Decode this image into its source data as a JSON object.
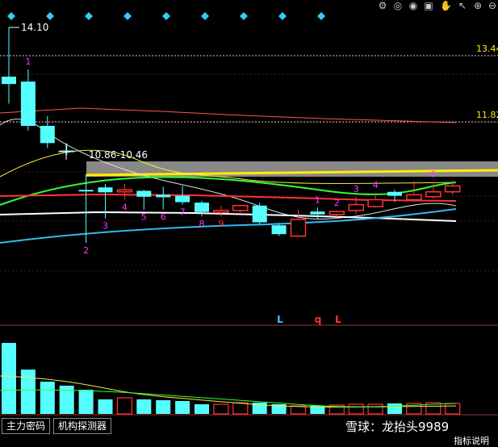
{
  "chart_data": {
    "type": "candlestick",
    "price_labels": {
      "high": "14.10",
      "range": "10.86-10.46",
      "right_top": "13.44",
      "right_mid": "11.82"
    },
    "candles": [
      {
        "o": 13.1,
        "c": 12.95,
        "h": 14.1,
        "l": 12.55,
        "up": false
      },
      {
        "o": 13.0,
        "c": 12.1,
        "h": 13.25,
        "l": 12.0,
        "up": false
      },
      {
        "o": 12.1,
        "c": 11.75,
        "h": 12.3,
        "l": 11.65,
        "up": false
      },
      {
        "o": 11.6,
        "c": 11.6,
        "h": 11.75,
        "l": 11.5,
        "up": false
      },
      {
        "o": 10.8,
        "c": 10.78,
        "h": 11.12,
        "l": 9.72,
        "up": false
      },
      {
        "o": 10.85,
        "c": 10.75,
        "h": 10.92,
        "l": 10.22,
        "up": false
      },
      {
        "o": 10.8,
        "c": 10.76,
        "h": 10.92,
        "l": 10.6,
        "up": true
      },
      {
        "o": 10.78,
        "c": 10.66,
        "h": 10.8,
        "l": 10.4,
        "up": false
      },
      {
        "o": 10.7,
        "c": 10.65,
        "h": 10.86,
        "l": 10.4,
        "up": false
      },
      {
        "o": 10.68,
        "c": 10.55,
        "h": 10.88,
        "l": 10.5,
        "up": false
      },
      {
        "o": 10.54,
        "c": 10.35,
        "h": 10.58,
        "l": 10.26,
        "up": false
      },
      {
        "o": 10.34,
        "c": 10.38,
        "h": 10.48,
        "l": 10.26,
        "up": true
      },
      {
        "o": 10.38,
        "c": 10.48,
        "h": 10.5,
        "l": 10.34,
        "up": true
      },
      {
        "o": 10.48,
        "c": 10.14,
        "h": 10.54,
        "l": 10.1,
        "up": false
      },
      {
        "o": 10.08,
        "c": 9.9,
        "h": 10.12,
        "l": 9.86,
        "up": false
      },
      {
        "o": 9.86,
        "c": 10.2,
        "h": 10.4,
        "l": 9.84,
        "up": true
      },
      {
        "o": 10.36,
        "c": 10.3,
        "h": 10.44,
        "l": 10.2,
        "up": false
      },
      {
        "o": 10.3,
        "c": 10.36,
        "h": 10.38,
        "l": 10.25,
        "up": true
      },
      {
        "o": 10.38,
        "c": 10.5,
        "h": 10.66,
        "l": 10.3,
        "up": true
      },
      {
        "o": 10.46,
        "c": 10.6,
        "h": 10.74,
        "l": 10.44,
        "up": true
      },
      {
        "o": 10.68,
        "c": 10.76,
        "h": 10.8,
        "l": 10.56,
        "up": false
      },
      {
        "o": 10.6,
        "c": 10.7,
        "h": 10.98,
        "l": 10.58,
        "up": true
      },
      {
        "o": 10.66,
        "c": 10.76,
        "h": 10.96,
        "l": 10.62,
        "up": true
      },
      {
        "o": 10.76,
        "c": 10.88,
        "h": 11.0,
        "l": 10.7,
        "up": true
      }
    ],
    "candle_labels": [
      {
        "i": 1,
        "t": "1",
        "c": "#ff33ff",
        "pos": "above"
      },
      {
        "i": 4,
        "t": "2",
        "c": "#ff33ff",
        "pos": "below"
      },
      {
        "i": 5,
        "t": "3",
        "c": "#ff33ff",
        "pos": "below"
      },
      {
        "i": 6,
        "t": "4",
        "c": "#ff33ff",
        "pos": "below"
      },
      {
        "i": 7,
        "t": "5",
        "c": "#ff33ff",
        "pos": "below"
      },
      {
        "i": 8,
        "t": "6",
        "c": "#ff33ff",
        "pos": "below"
      },
      {
        "i": 9,
        "t": "7",
        "c": "#ff33ff",
        "pos": "below"
      },
      {
        "i": 10,
        "t": "8",
        "c": "#ff33ff",
        "pos": "below"
      },
      {
        "i": 11,
        "t": "9",
        "c": "#ff3333",
        "pos": "below"
      },
      {
        "i": 16,
        "t": "1",
        "c": "#ff33ff",
        "pos": "above"
      },
      {
        "i": 17,
        "t": "2",
        "c": "#ff33ff",
        "pos": "above"
      },
      {
        "i": 18,
        "t": "3",
        "c": "#ff33ff",
        "pos": "above"
      },
      {
        "i": 19,
        "t": "4",
        "c": "#ff33ff",
        "pos": "above"
      },
      {
        "i": 22,
        "t": "6",
        "c": "#ff33ff",
        "pos": "above"
      }
    ],
    "signals": [
      {
        "t": "L",
        "c": "#33ccff"
      },
      {
        "t": "q",
        "c": "#ff3333"
      },
      {
        "t": "L",
        "c": "#ff3333"
      }
    ],
    "volumes": [
      88,
      55,
      40,
      35,
      30,
      18,
      20,
      18,
      17,
      16,
      12,
      12,
      14,
      14,
      12,
      10,
      10,
      11,
      12,
      12,
      13,
      13,
      14,
      13
    ]
  },
  "tabs": {
    "tab1": "主力密码",
    "tab2": "机构探测器"
  },
  "watermark": "雪球：龙抬头9989",
  "indicator_label": "指标说明",
  "colors": {
    "up": "#ff3333",
    "down": "#55ffff",
    "bg": "#000000"
  }
}
